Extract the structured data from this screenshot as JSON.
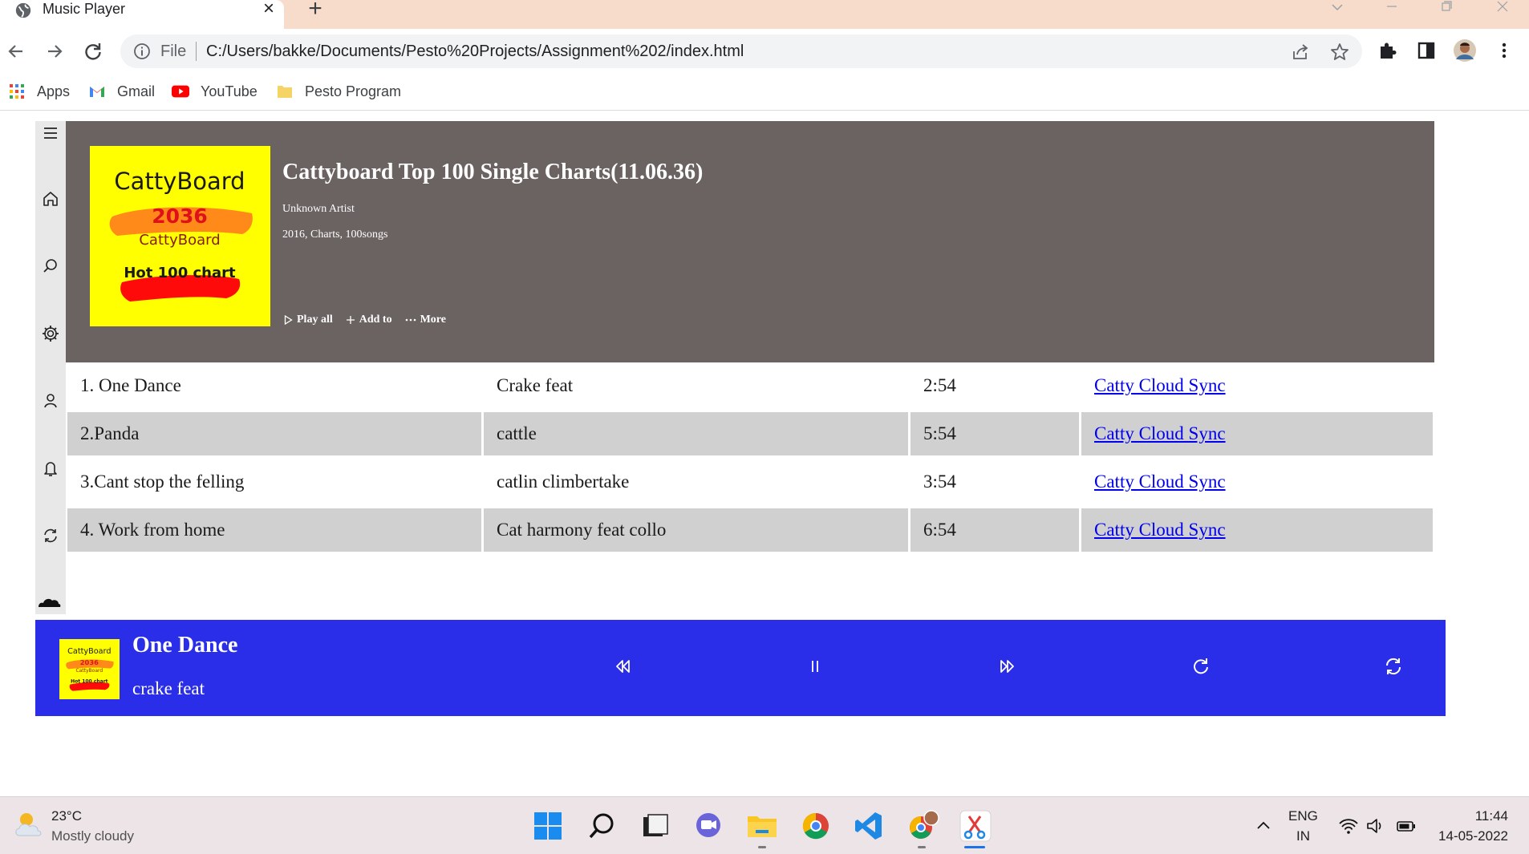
{
  "browser": {
    "tab_title": "Music Player",
    "tab_close": "×",
    "new_tab": "+",
    "scheme_label": "File",
    "url": "C:/Users/bakke/Documents/Pesto%20Projects/Assignment%202/index.html",
    "bookmarks": [
      {
        "label": "Apps",
        "icon": "apps-grid-icon"
      },
      {
        "label": "Gmail",
        "icon": "gmail-icon"
      },
      {
        "label": "YouTube",
        "icon": "youtube-icon"
      },
      {
        "label": "Pesto Program",
        "icon": "folder-icon"
      }
    ]
  },
  "album": {
    "cover": {
      "line1": "CattyBoard",
      "line2": "2036",
      "line3": "CattyBoard",
      "line4": "Hot 100 chart"
    },
    "title": "Cattyboard Top 100 Single Charts(11.06.36)",
    "artist": "Unknown Artist",
    "meta": "2016, Charts, 100songs",
    "actions": {
      "play_all": "Play all",
      "add_to": "Add to",
      "more": "More"
    }
  },
  "tracks": [
    {
      "title": "1. One Dance",
      "artist": "Crake feat",
      "duration": "2:54",
      "link": "Catty Cloud Sync"
    },
    {
      "title": "2.Panda",
      "artist": "cattle",
      "duration": "5:54",
      "link": "Catty Cloud Sync"
    },
    {
      "title": "3.Cant stop the felling",
      "artist": "catlin climbertake",
      "duration": "3:54",
      "link": "Catty Cloud Sync"
    },
    {
      "title": "4. Work from home",
      "artist": "Cat harmony feat collo",
      "duration": "6:54",
      "link": "Catty Cloud Sync"
    }
  ],
  "player": {
    "title": "One Dance",
    "artist": "crake feat",
    "mini_cover": {
      "line1": "CattyBoard",
      "line2": "2036",
      "line3": "CattyBoard",
      "line4": "Hot 100 chart"
    }
  },
  "taskbar": {
    "temperature": "23°C",
    "condition": "Mostly cloudy",
    "lang_line1": "ENG",
    "lang_line2": "IN",
    "time": "11:44",
    "date": "14-05-2022"
  },
  "colors": {
    "header_bg": "#6b6262",
    "player_bg": "#2b2ee8",
    "cover_bg": "#ffff00",
    "row_alt_bg": "#d0d0d0",
    "link": "#0000ee",
    "tabstrip_bg": "#f7dccb"
  }
}
